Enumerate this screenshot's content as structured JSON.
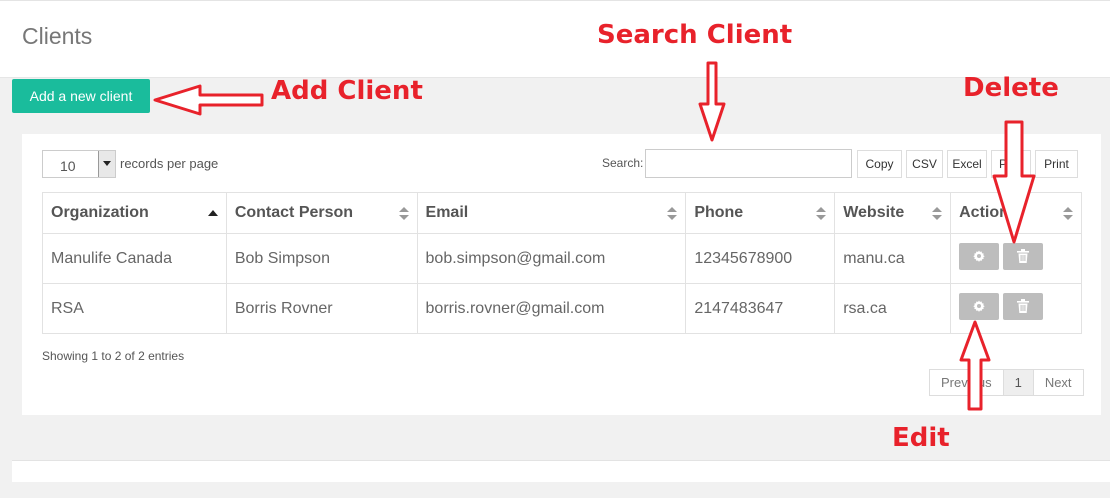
{
  "header": {
    "title": "Clients"
  },
  "toolbar": {
    "add_label": "Add a new client"
  },
  "length": {
    "value": "10",
    "label": "records per page"
  },
  "search": {
    "label": "Search:",
    "value": ""
  },
  "export": [
    {
      "label": "Copy"
    },
    {
      "label": "CSV"
    },
    {
      "label": "Excel"
    },
    {
      "label": "PDF"
    },
    {
      "label": "Print"
    }
  ],
  "table": {
    "columns": [
      "Organization",
      "Contact Person",
      "Email",
      "Phone",
      "Website",
      "Actions"
    ],
    "rows": [
      {
        "organization": "Manulife Canada",
        "contact": "Bob Simpson",
        "email": "bob.simpson@gmail.com",
        "phone": "12345678900",
        "website": "manu.ca"
      },
      {
        "organization": "RSA",
        "contact": "Borris Rovner",
        "email": "borris.rovner@gmail.com",
        "phone": "2147483647",
        "website": "rsa.ca"
      }
    ]
  },
  "info": "Showing 1 to 2 of 2 entries",
  "pagination": {
    "prev": "Previous",
    "current": "1",
    "next": "Next"
  },
  "annotations": {
    "search": "Search Client",
    "add": "Add Client",
    "delete": "Delete",
    "edit": "Edit"
  },
  "colors": {
    "accent": "#1abc9c",
    "annotation": "#e8222b",
    "action_button": "#bdbdbd"
  }
}
